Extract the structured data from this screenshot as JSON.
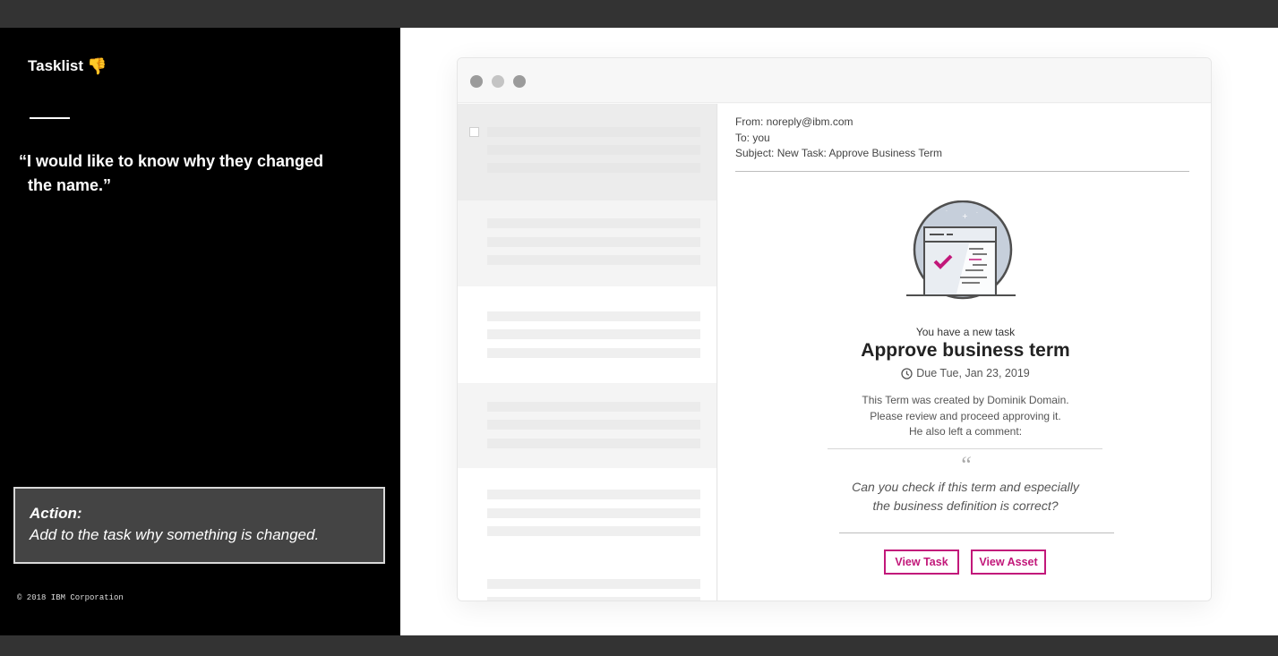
{
  "sidebar": {
    "title": "Tasklist",
    "title_emoji": "👎",
    "quote_line1": "“I would like to know why they changed",
    "quote_line2": "the name.”",
    "action_label": "Action:",
    "action_text": "Add to the task why something is changed.",
    "copyright": "© 2018 IBM Corporation"
  },
  "window": {
    "traffic_light_colors": [
      "#9b9b9b",
      "#c4c4c4",
      "#9b9b9b"
    ]
  },
  "email": {
    "from": "From: noreply@ibm.com",
    "to": "To: you",
    "subject": "Subject: New Task: Approve Business Term",
    "intro": "You have a new task",
    "heading": "Approve business term",
    "due": "Due Tue, Jan 23, 2019",
    "body_line1": "This Term was created by Dominik Domain.",
    "body_line2": "Please review and proceed approving it.",
    "body_line3": "He also left a comment:",
    "quote_mark": "“",
    "comment_line1": "Can you check if this term and especially",
    "comment_line2": "the business definition is correct?",
    "view_task_label": "View Task",
    "view_asset_label": "View Asset"
  },
  "colors": {
    "accent": "#c2187a",
    "left_panel_bg": "#000000",
    "action_box_bg": "#444444"
  }
}
